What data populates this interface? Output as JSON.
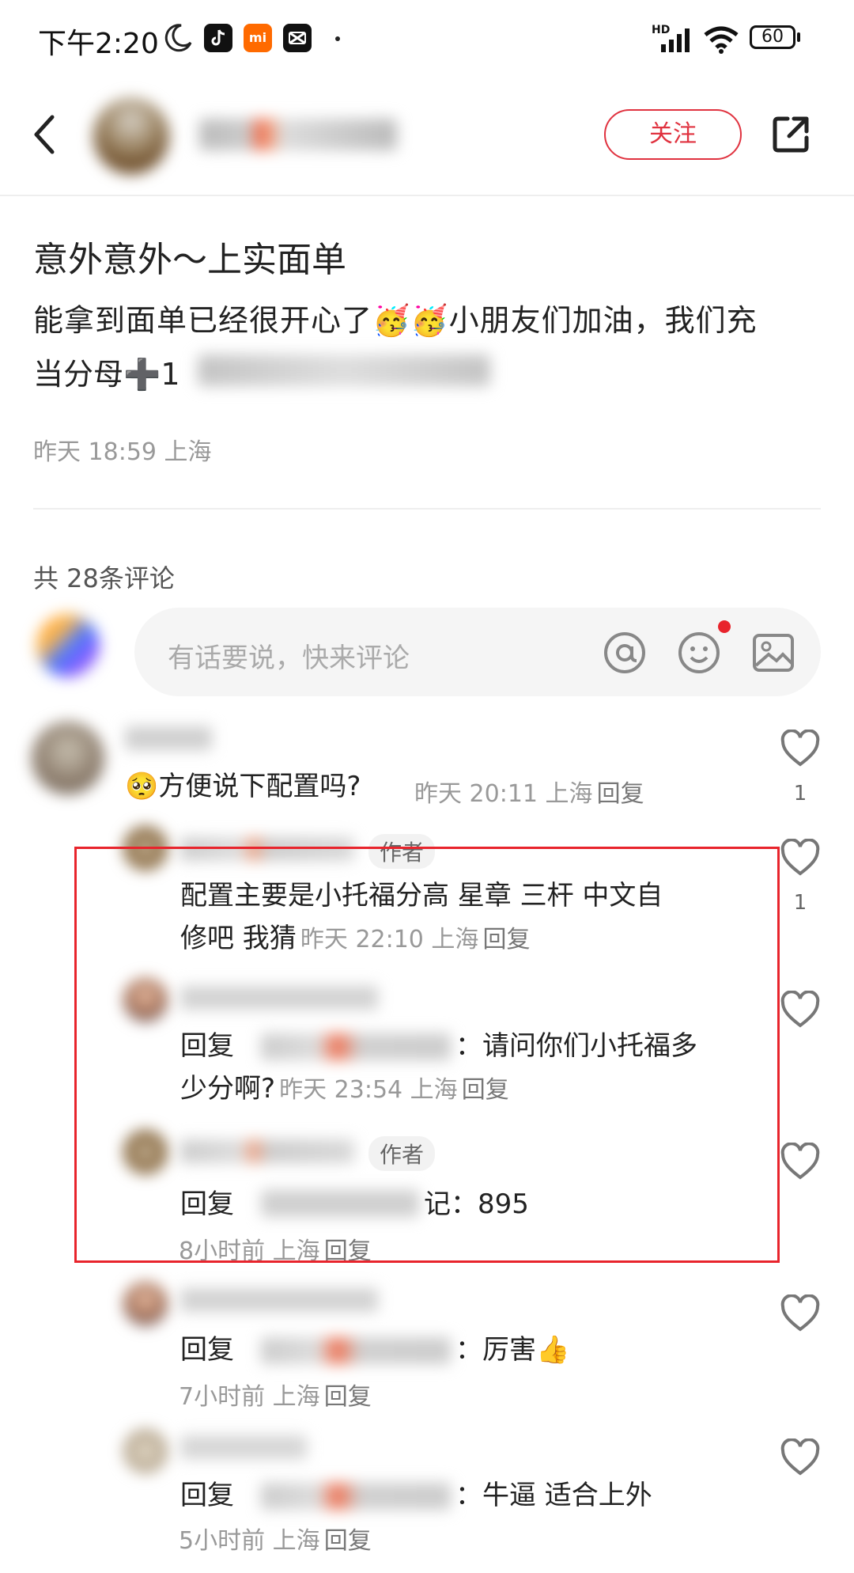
{
  "status_bar": {
    "time": "下午2:20",
    "battery": "60",
    "hd_label": "HD"
  },
  "header": {
    "follow_label": "关注"
  },
  "post": {
    "title": "意外意外～上实面单",
    "body_line1": "能拿到面单已经很开心了🥳🥳小朋友们加油，我们充",
    "body_line2_visible": "当分母➕1",
    "meta": "昨天 18:59 上海"
  },
  "comments_section": {
    "count_label": "共 28条评论",
    "input_placeholder": "有话要说，快来评论"
  },
  "comments": [
    {
      "text": "🥺方便说下配置吗?",
      "meta": "昨天 20:11 上海",
      "reply": "回复",
      "likes": "1"
    }
  ],
  "replies": [
    {
      "author_badge": "作者",
      "text_line1": "配置主要是小托福分高 星章 三杆 中文自",
      "text_line2": "修吧 我猜",
      "meta": "昨天 22:10 上海",
      "reply": "回复",
      "likes": "1"
    },
    {
      "prefix": "回复",
      "suffix": "：请问你们小托福多",
      "text_line2": "少分啊?",
      "meta": "昨天 23:54 上海",
      "reply": "回复"
    },
    {
      "author_badge": "作者",
      "prefix": "回复",
      "suffix": "记：895",
      "meta": "8小时前 上海",
      "reply": "回复"
    },
    {
      "prefix": "回复",
      "suffix": "：厉害👍",
      "meta": "7小时前 上海",
      "reply": "回复"
    },
    {
      "prefix": "回复",
      "suffix": "：牛逼 适合上外",
      "meta": "5小时前 上海",
      "reply": "回复"
    }
  ],
  "colors": {
    "accent_red": "#e0323f",
    "highlight_box": "#e8242c"
  }
}
